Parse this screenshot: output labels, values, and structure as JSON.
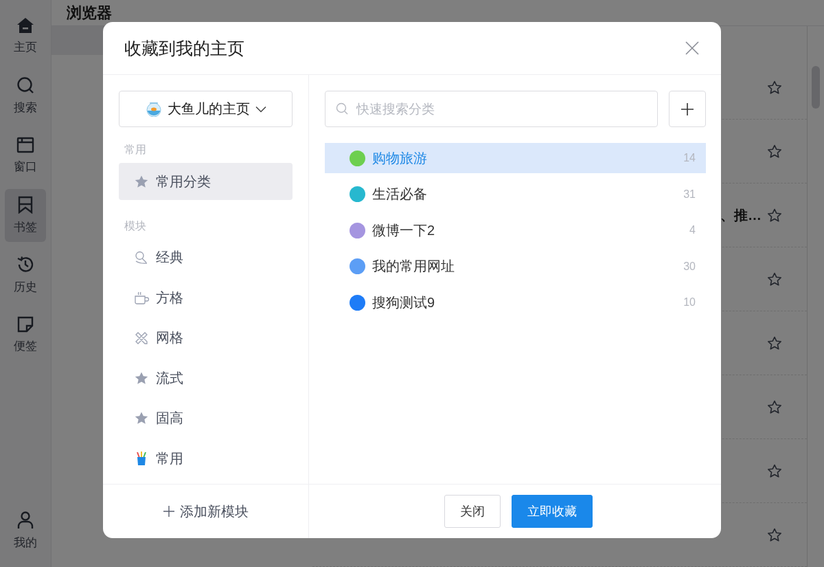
{
  "nav": [
    {
      "label": "主页",
      "selected": false
    },
    {
      "label": "搜索",
      "selected": false
    },
    {
      "label": "窗口",
      "selected": false
    },
    {
      "label": "书签",
      "selected": true
    },
    {
      "label": "历史",
      "selected": false
    },
    {
      "label": "便签",
      "selected": false
    }
  ],
  "nav_bottom": {
    "label": "我的",
    "selected": false
  },
  "page": {
    "title": "浏览器",
    "fragment": "、推…"
  },
  "dialog": {
    "title": "收藏到我的主页",
    "homepage_dropdown": {
      "value": "大鱼儿的主页"
    },
    "sections": [
      {
        "label": "常用",
        "items": [
          {
            "label": "常用分类",
            "kind": "star",
            "selected": true
          }
        ]
      },
      {
        "label": "模块",
        "items": [
          {
            "label": "经典",
            "kind": "magnifier",
            "selected": false
          },
          {
            "label": "方格",
            "kind": "cup",
            "selected": false
          },
          {
            "label": "网格",
            "kind": "tools",
            "selected": false
          },
          {
            "label": "流式",
            "kind": "star",
            "selected": false
          },
          {
            "label": "固高",
            "kind": "star",
            "selected": false
          },
          {
            "label": "常用",
            "kind": "pencils",
            "selected": false
          }
        ]
      }
    ],
    "add_module": "添加新模块",
    "search": {
      "placeholder": "快速搜索分类"
    },
    "categories": [
      {
        "name": "购物旅游",
        "count": "14",
        "color": "#6dcf4f",
        "selected": true
      },
      {
        "name": "生活必备",
        "count": "31",
        "color": "#27b8cf",
        "selected": false
      },
      {
        "name": "微博一下2",
        "count": "4",
        "color": "#a595e0",
        "selected": false
      },
      {
        "name": "我的常用网址",
        "count": "30",
        "color": "#5c9ef5",
        "selected": false
      },
      {
        "name": "搜狗测试9",
        "count": "10",
        "color": "#1e7cf7",
        "selected": false
      }
    ],
    "buttons": [
      {
        "label": "关闭",
        "kind": "secondary"
      },
      {
        "label": "立即收藏",
        "kind": "primary"
      }
    ]
  }
}
